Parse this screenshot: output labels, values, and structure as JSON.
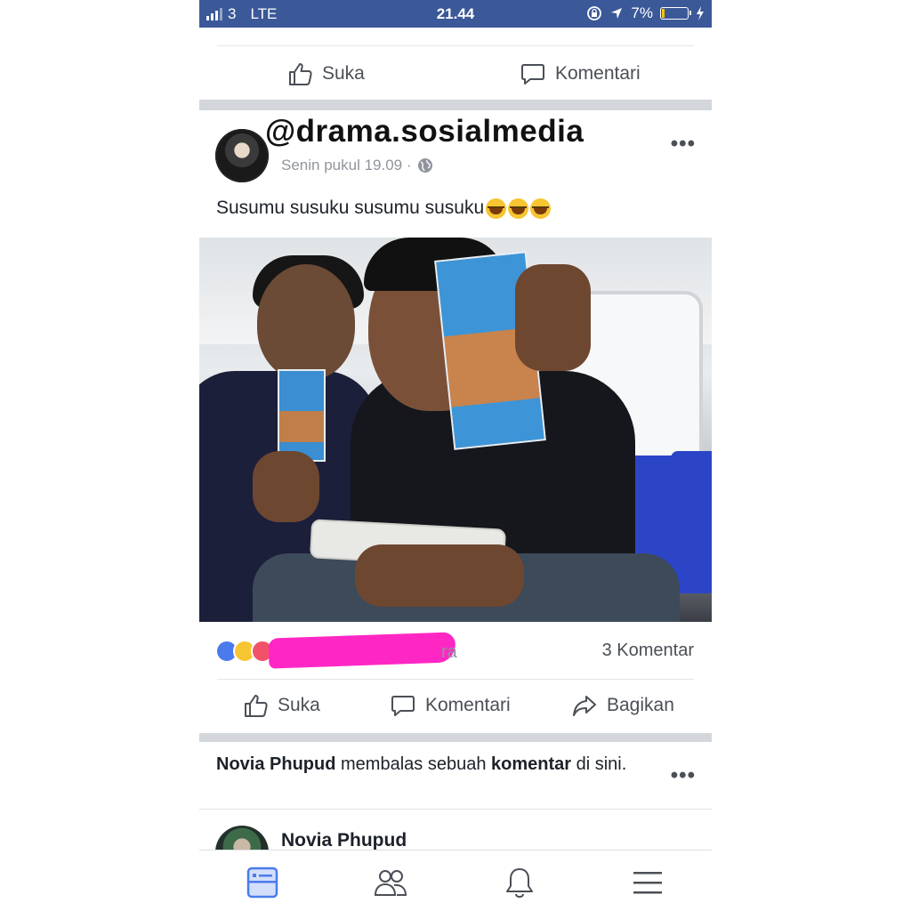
{
  "status_bar": {
    "carrier": "3",
    "network": "LTE",
    "time": "21.44",
    "battery": "7%",
    "battery_color": "#f5c400"
  },
  "prev_post": {
    "like_label": "Suka",
    "comment_label": "Komentari"
  },
  "post": {
    "watermark": "@drama.sosialmedia",
    "timestamp": "Senin pukul 19.09 ·",
    "privacy_icon": "globe-icon",
    "text": "Susumu susuku susumu susuku",
    "emojis": [
      "tears-of-joy",
      "tears-of-joy",
      "tears-of-joy"
    ],
    "reaction_tail": "ra",
    "comment_count": "3 Komentar",
    "actions": {
      "like": "Suka",
      "comment": "Komentari",
      "share": "Bagikan"
    }
  },
  "notification": {
    "actor": "Novia Phupud",
    "middle": " membalas sebuah ",
    "object": "komentar",
    "suffix": " di sini."
  },
  "reply": {
    "name": "Novia Phupud"
  },
  "nav": [
    "news-feed-icon",
    "friends-icon",
    "notifications-icon",
    "menu-icon"
  ],
  "colors": {
    "brand": "#3b5998",
    "accent": "#4a7bec",
    "redaction": "#ff27c4"
  }
}
